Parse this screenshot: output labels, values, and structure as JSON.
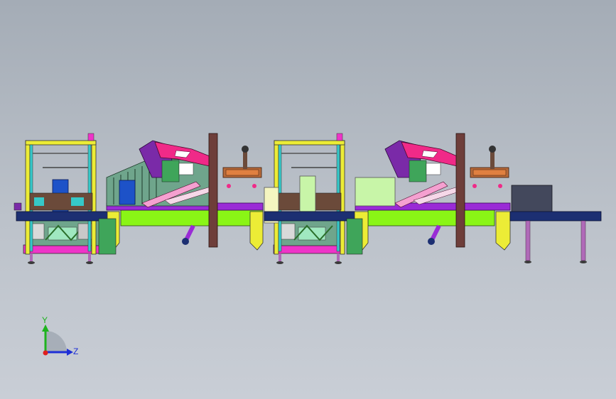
{
  "triad": {
    "y_label": "Y",
    "z_label": "Z",
    "y_color": "#1eb31e",
    "z_color": "#1e2fd6",
    "origin_color": "#e01e1e"
  },
  "palette": {
    "frame_yellow": "#ecec36",
    "frame_cyan": "#36c8c8",
    "conveyor_green": "#8af516",
    "conveyor_purple": "#9a2bd6",
    "navy_belt": "#1c2f72",
    "post_brown": "#6e3e3a",
    "arm_magenta": "#f02a88",
    "arm_purple": "#7a2aa8",
    "box_blue": "#1d52c8",
    "box_cream": "#f5f5c0",
    "box_lightgreen": "#c8f5a8",
    "dark_box": "#43485c",
    "legs": "#b06ab8"
  }
}
